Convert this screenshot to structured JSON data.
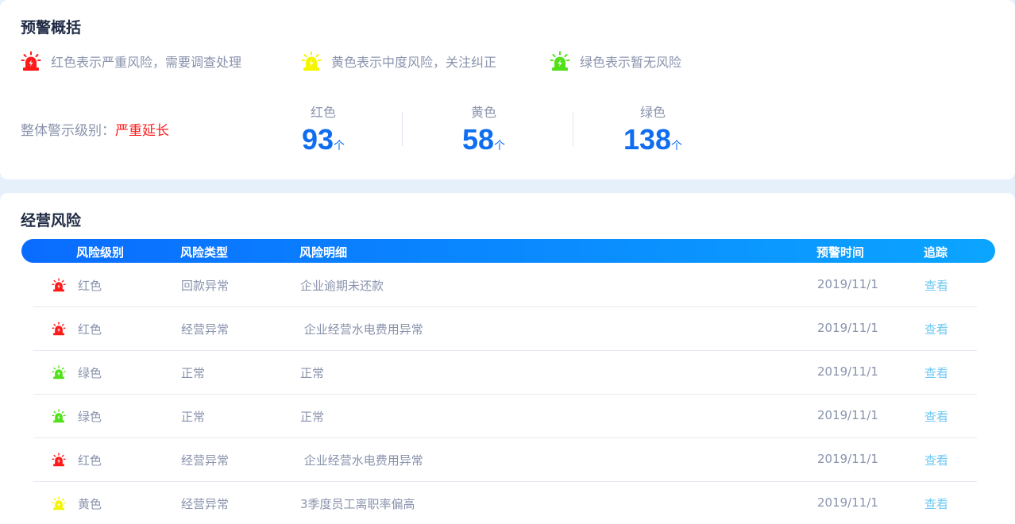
{
  "summary": {
    "title": "预警概括",
    "legend": [
      {
        "text": "红色表示严重风险，需要调查处理",
        "color": "#ff1a1a",
        "icon": "alarm-light-red-icon"
      },
      {
        "text": "黄色表示中度风险，关注纠正",
        "color": "#f5f500",
        "icon": "alarm-light-yellow-icon"
      },
      {
        "text": "绿色表示暂无风险",
        "color": "#52e01a",
        "icon": "alarm-light-green-icon"
      }
    ],
    "overall_label": "整体警示级别：",
    "overall_value": "严重延长",
    "stats": [
      {
        "label": "红色",
        "value": "93",
        "unit": "个"
      },
      {
        "label": "黄色",
        "value": "58",
        "unit": "个"
      },
      {
        "label": "绿色",
        "value": "138",
        "unit": "个"
      }
    ]
  },
  "risk": {
    "title": "经营风险",
    "columns": [
      "风险级别",
      "风险类型",
      "风险明细",
      "预警时间",
      "追踪"
    ],
    "rows": [
      {
        "level": "红色",
        "color": "#ff1a1a",
        "type": "回款异常",
        "detail": "企业逾期未还款",
        "time": "2019/11/1",
        "action": "查看"
      },
      {
        "level": "红色",
        "color": "#ff1a1a",
        "type": "经营异常",
        "detail": " 企业经营水电费用异常",
        "time": "2019/11/1",
        "action": "查看"
      },
      {
        "level": "绿色",
        "color": "#52e01a",
        "type": "正常",
        "detail": "正常",
        "time": "2019/11/1",
        "action": "查看"
      },
      {
        "level": "绿色",
        "color": "#52e01a",
        "type": "正常",
        "detail": "正常",
        "time": "2019/11/1",
        "action": "查看"
      },
      {
        "level": "红色",
        "color": "#ff1a1a",
        "type": "经营异常",
        "detail": " 企业经营水电费用异常",
        "time": "2019/11/1",
        "action": "查看"
      },
      {
        "level": "黄色",
        "color": "#f5f500",
        "type": "经营异常",
        "detail": "3季度员工离职率偏高",
        "time": "2019/11/1",
        "action": "查看"
      }
    ]
  }
}
